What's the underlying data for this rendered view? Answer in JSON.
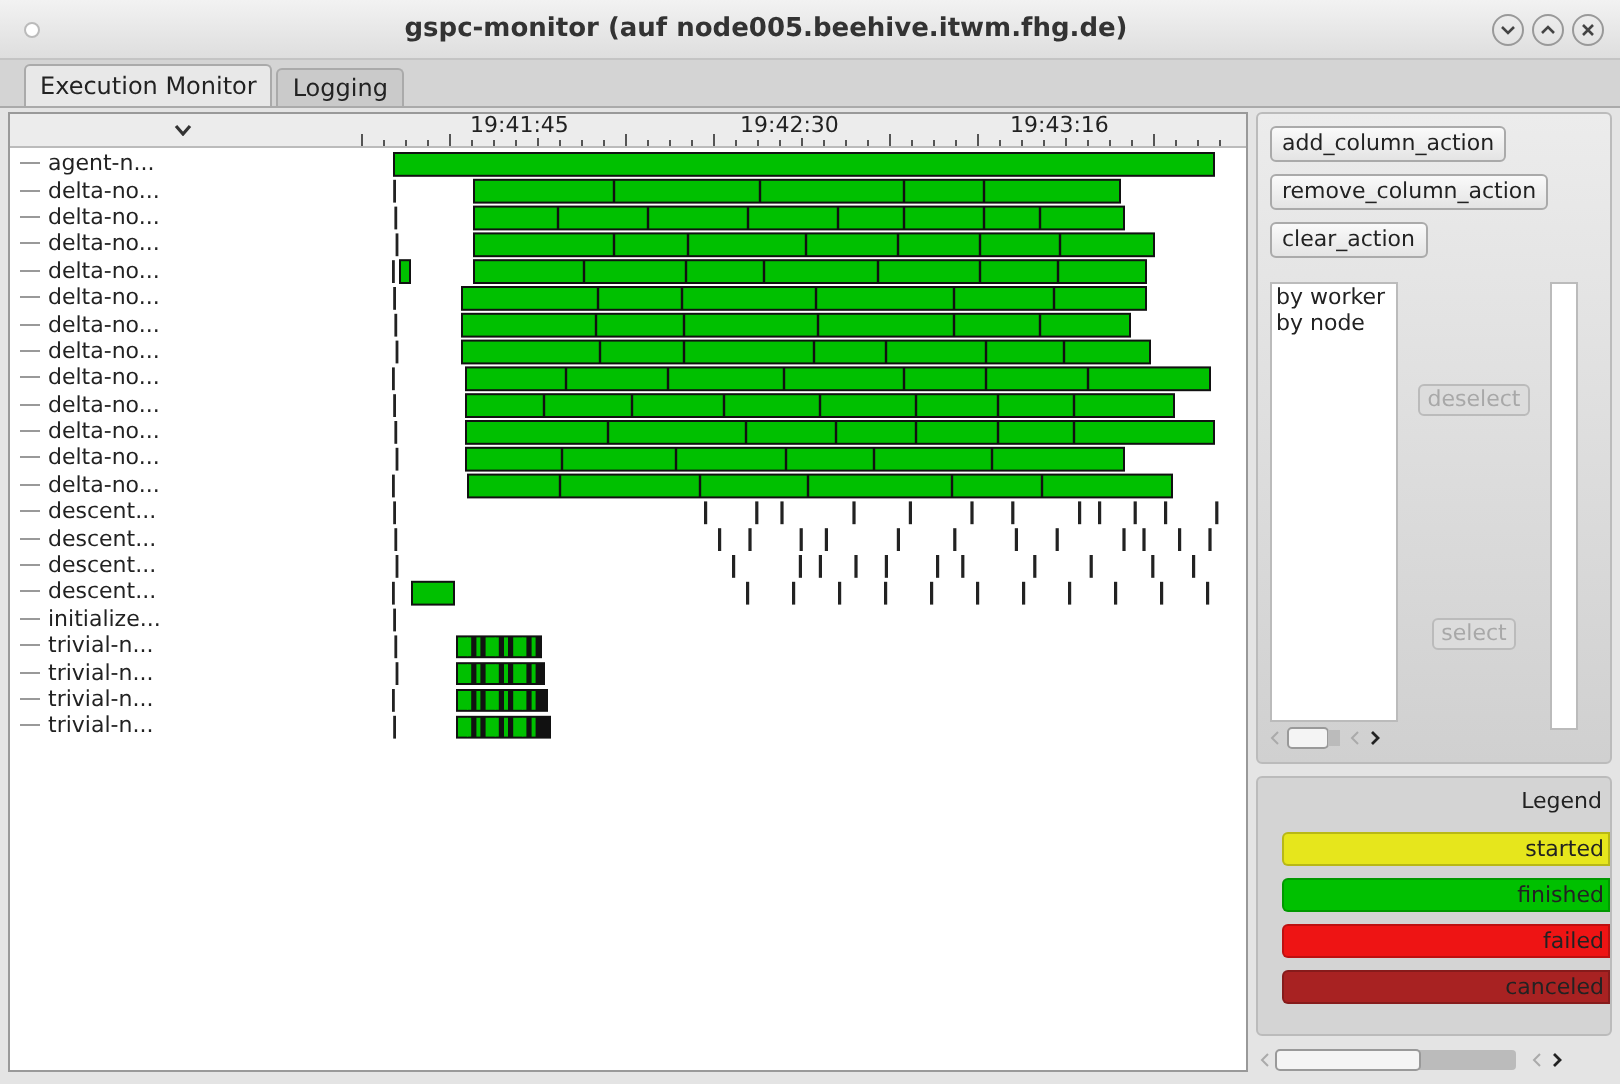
{
  "window": {
    "title": "gspc-monitor (auf node005.beehive.itwm.fhg.de)"
  },
  "tabs": [
    {
      "label": "Execution Monitor",
      "selected": true
    },
    {
      "label": "Logging",
      "selected": false
    }
  ],
  "time_axis": [
    "19:41:45",
    "19:42:30",
    "19:43:16"
  ],
  "tree": {
    "rows": [
      "agent-n...",
      "delta-no...",
      "delta-no...",
      "delta-no...",
      "delta-no...",
      "delta-no...",
      "delta-no...",
      "delta-no...",
      "delta-no...",
      "delta-no...",
      "delta-no...",
      "delta-no...",
      "delta-no...",
      "descent...",
      "descent...",
      "descent...",
      "descent...",
      "initialize...",
      "trivial-n...",
      "trivial-n...",
      "trivial-n...",
      "trivial-n..."
    ]
  },
  "actions": [
    "add_column_action",
    "remove_column_action",
    "clear_action"
  ],
  "grouping": {
    "items": [
      "by worker",
      "by node"
    ],
    "deselect": {
      "label": "deselect",
      "disabled": true
    },
    "select": {
      "label": "select",
      "disabled": true
    }
  },
  "legend": {
    "title": "Legend",
    "items": [
      {
        "label": "started",
        "color": "#e6e61c"
      },
      {
        "label": "finished",
        "color": "#00c000"
      },
      {
        "label": "failed",
        "color": "#ee1414"
      },
      {
        "label": "canceled",
        "color": "#a82222"
      }
    ]
  }
}
